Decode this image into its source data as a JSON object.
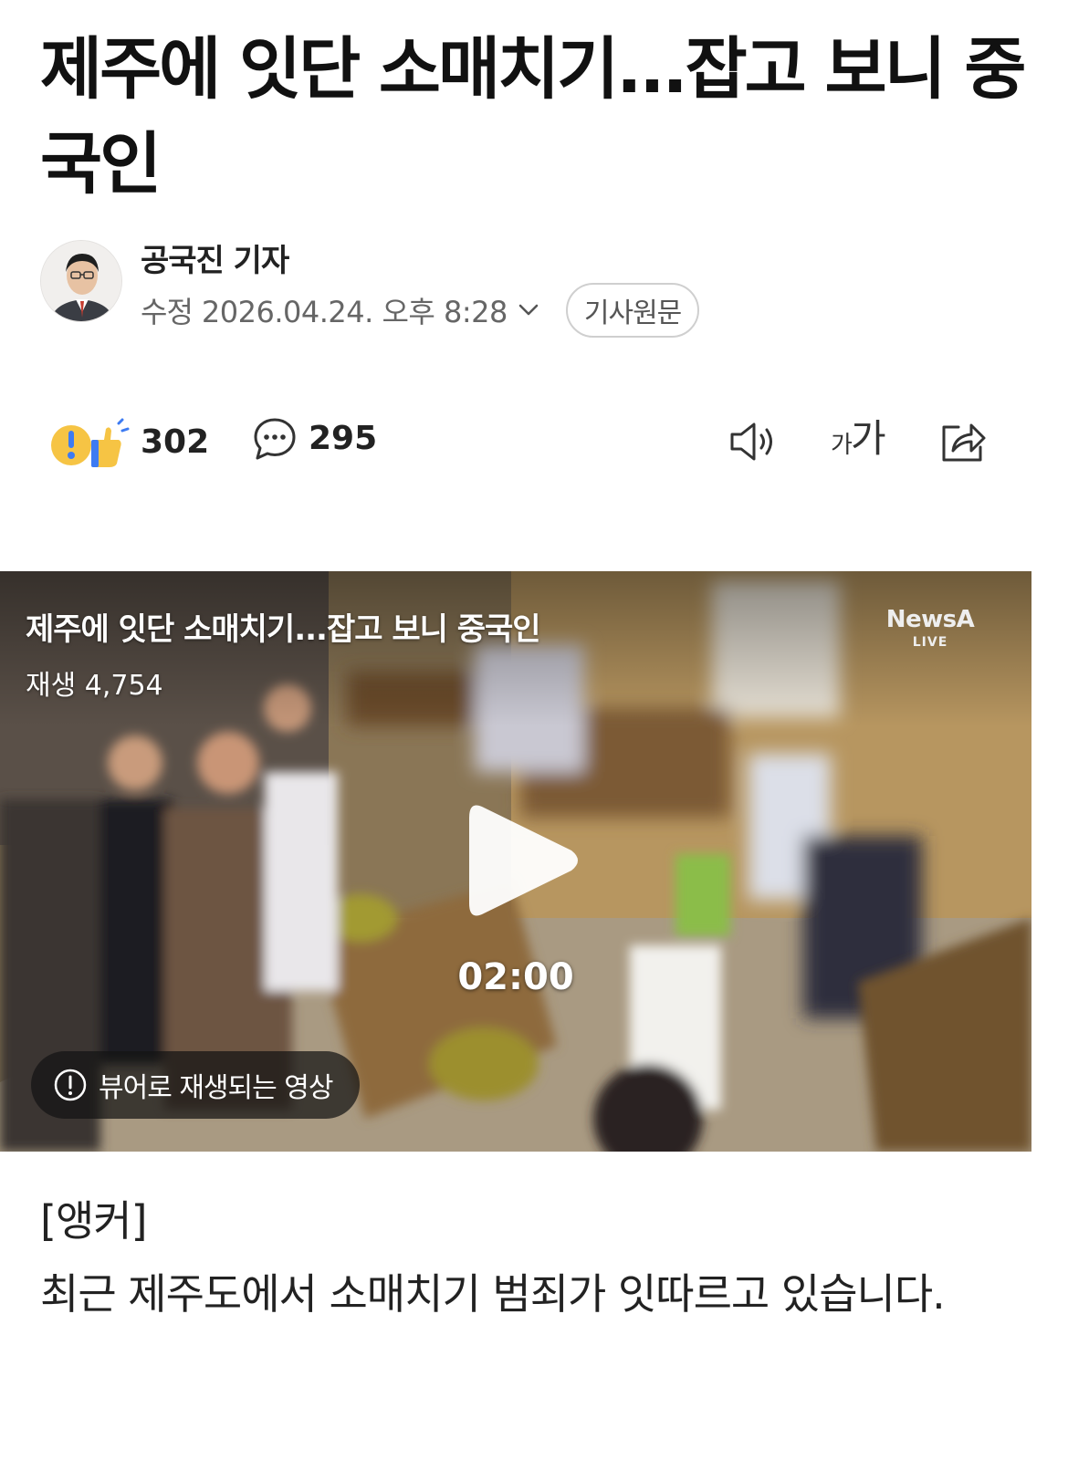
{
  "article": {
    "headline": "제주에 잇단 소매치기...잡고 보니 중국인",
    "reporter": "공국진 기자",
    "modified_label": "수정",
    "modified_datetime": "2026.04.24. 오후 8:28",
    "original_article_label": "기사원문"
  },
  "actions": {
    "reaction_count": "302",
    "comment_count": "295"
  },
  "video": {
    "title": "제주에 잇단 소매치기...잡고 보니 중국인",
    "views": "재생 4,754",
    "duration": "02:00",
    "viewer_notice": "뷰어로 재생되는 영상",
    "channel_name": "NewsA",
    "channel_sub": "LIVE"
  },
  "body": {
    "anchor_label": "[앵커]",
    "paragraph_1": "최근 제주도에서 소매치기 범죄가 잇따르고 있습니다."
  },
  "colors": {
    "text_primary": "#111111",
    "text_secondary": "#666666",
    "reaction_yellow": "#f6c444",
    "reaction_blue": "#3d7bf2"
  }
}
